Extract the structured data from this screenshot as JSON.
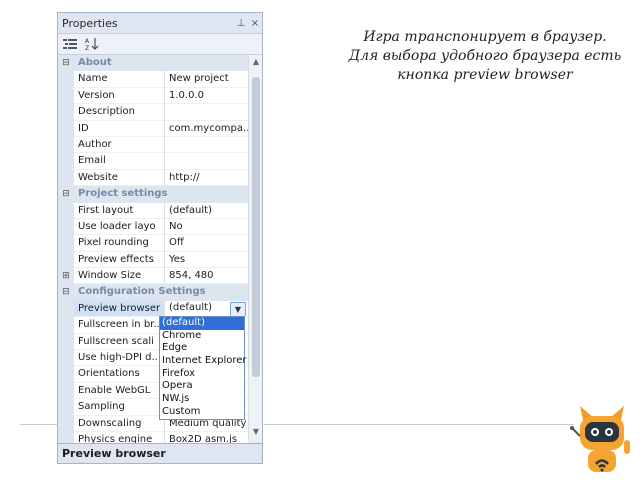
{
  "panel": {
    "title": "Properties",
    "title_buttons": [
      "⊥",
      "×"
    ],
    "toolbar": {
      "categorized_icon": "categorized-icon",
      "alphabetical_icon": "sort-az-icon"
    }
  },
  "rows": [
    {
      "type": "cat",
      "label": "About",
      "expand": "⊟"
    },
    {
      "type": "prop",
      "name": "Name",
      "value": "New project"
    },
    {
      "type": "prop",
      "name": "Version",
      "value": "1.0.0.0"
    },
    {
      "type": "prop",
      "name": "Description",
      "value": ""
    },
    {
      "type": "prop",
      "name": "ID",
      "value": "com.mycompa..."
    },
    {
      "type": "prop",
      "name": "Author",
      "value": ""
    },
    {
      "type": "prop",
      "name": "Email",
      "value": ""
    },
    {
      "type": "prop",
      "name": "Website",
      "value": "http://"
    },
    {
      "type": "cat",
      "label": "Project settings",
      "expand": "⊟"
    },
    {
      "type": "prop",
      "name": "First layout",
      "value": "(default)"
    },
    {
      "type": "prop",
      "name": "Use loader layo",
      "value": "No"
    },
    {
      "type": "prop",
      "name": "Pixel rounding",
      "value": "Off"
    },
    {
      "type": "prop",
      "name": "Preview effects",
      "value": "Yes"
    },
    {
      "type": "prop",
      "name": "Window Size",
      "value": "854, 480",
      "expand": "⊞"
    },
    {
      "type": "cat",
      "label": "Configuration Settings",
      "expand": "⊟"
    },
    {
      "type": "prop",
      "name": "Preview browser",
      "value": "(default)",
      "selected": true,
      "combo": true
    },
    {
      "type": "prop",
      "name": "Fullscreen in br...",
      "value": ""
    },
    {
      "type": "prop",
      "name": "Fullscreen scali",
      "value": ""
    },
    {
      "type": "prop",
      "name": "Use high-DPI d...",
      "value": ""
    },
    {
      "type": "prop",
      "name": "Orientations",
      "value": ""
    },
    {
      "type": "prop",
      "name": "Enable WebGL",
      "value": ""
    },
    {
      "type": "prop",
      "name": "Sampling",
      "value": ""
    },
    {
      "type": "prop",
      "name": "Downscaling",
      "value": "Medium quality"
    },
    {
      "type": "prop",
      "name": "Physics engine",
      "value": "Box2D asm.js"
    }
  ],
  "dropdown": {
    "options": [
      "(default)",
      "Chrome",
      "Edge",
      "Internet Explorer",
      "Firefox",
      "Opera",
      "NW.js",
      "Custom"
    ],
    "highlighted_index": 0
  },
  "footer": {
    "label": "Preview browser"
  },
  "caption": {
    "line1": "Игра транспонирует в браузер.",
    "line2": "Для выбора удобного браузера есть",
    "line3": "кнопка preview browser"
  },
  "colors": {
    "highlight": "#2f6fd6",
    "category_text": "#7a8aa3",
    "panel_bg": "#e9eef6"
  }
}
